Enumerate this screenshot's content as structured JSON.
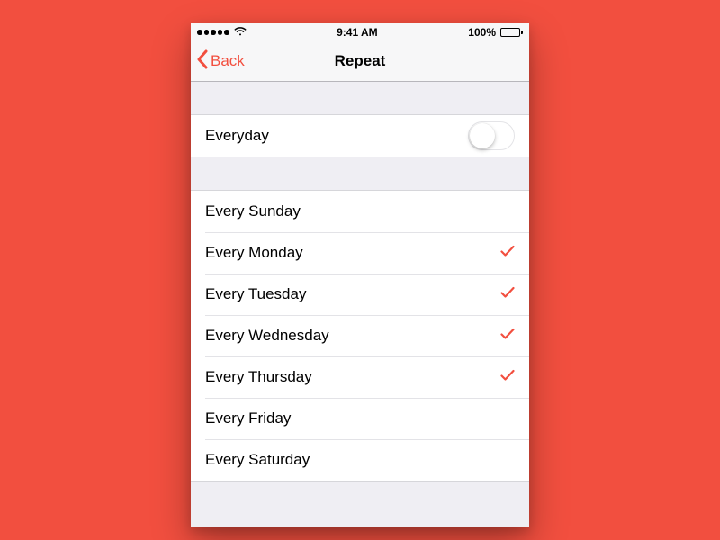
{
  "colors": {
    "accent": "#f24f3f",
    "stage_bg": "#f24f3f",
    "section_bg": "#ffffff",
    "group_bg": "#efeef3"
  },
  "status": {
    "time": "9:41 AM",
    "battery_pct": "100%"
  },
  "nav": {
    "back_label": "Back",
    "title": "Repeat"
  },
  "everyday": {
    "label": "Everyday",
    "on": false
  },
  "days": [
    {
      "label": "Every Sunday",
      "selected": false
    },
    {
      "label": "Every Monday",
      "selected": true
    },
    {
      "label": "Every Tuesday",
      "selected": true
    },
    {
      "label": "Every Wednesday",
      "selected": true
    },
    {
      "label": "Every Thursday",
      "selected": true
    },
    {
      "label": "Every Friday",
      "selected": false
    },
    {
      "label": "Every Saturday",
      "selected": false
    }
  ]
}
